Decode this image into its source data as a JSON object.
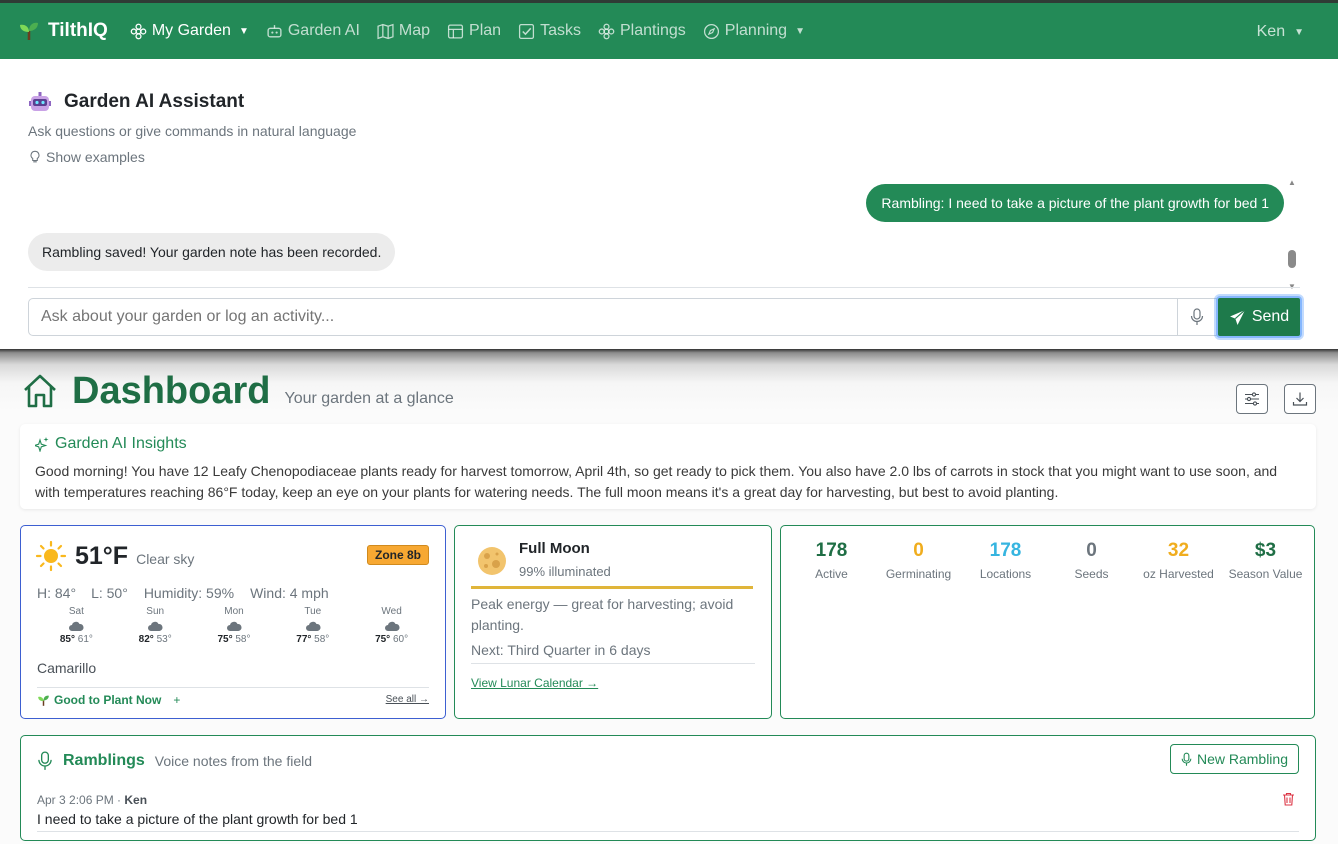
{
  "nav": {
    "brand": "TilthIQ",
    "my_garden": "My Garden",
    "items": [
      "Garden AI",
      "Map",
      "Plan",
      "Tasks",
      "Plantings",
      "Planning"
    ],
    "user": "Ken"
  },
  "assistant": {
    "title": "Garden AI Assistant",
    "subtitle": "Ask questions or give commands in natural language",
    "show_examples": "Show examples",
    "messages": [
      {
        "role": "user",
        "text": "Rambling: I need to take a picture of the plant growth for bed 1"
      },
      {
        "role": "assistant",
        "text": "Rambling saved! Your garden note has been recorded."
      }
    ],
    "input_placeholder": "Ask about your garden or log an activity...",
    "send_label": "Send"
  },
  "dashboard": {
    "title": "Dashboard",
    "subtitle": "Your garden at a glance"
  },
  "insights": {
    "title": "Garden AI Insights",
    "text": "Good morning! You have 12 Leafy Chenopodiaceae plants ready for harvest tomorrow, April 4th, so get ready to pick them. You also have 2.0 lbs of carrots in stock that you might want to use soon, and with temperatures reaching 86°F today, keep an eye on your plants for watering needs. The full moon means it's a great day for harvesting, but best to avoid planting."
  },
  "weather": {
    "temp": "51°F",
    "condition": "Clear sky",
    "zone": "Zone 8b",
    "high": "H: 84°",
    "low": "L: 50°",
    "humidity": "Humidity: 59%",
    "wind": "Wind: 4 mph",
    "forecast": [
      {
        "day": "Sat",
        "high": "85°",
        "low": "61°"
      },
      {
        "day": "Sun",
        "high": "82°",
        "low": "53°"
      },
      {
        "day": "Mon",
        "high": "75°",
        "low": "58°"
      },
      {
        "day": "Tue",
        "high": "77°",
        "low": "58°"
      },
      {
        "day": "Wed",
        "high": "75°",
        "low": "60°"
      }
    ],
    "city": "Camarillo",
    "good_to_plant": "Good to Plant Now",
    "plus": "+",
    "see_all": "See all →"
  },
  "moon": {
    "phase": "Full Moon",
    "illumination": "99% illuminated",
    "illumination_fraction": 0.99,
    "energy": "Peak energy — great for harvesting; avoid planting.",
    "next": "Next: Third Quarter in 6 days",
    "link": "View Lunar Calendar →"
  },
  "stats": [
    {
      "value": "178",
      "label": "Active",
      "color": "#1f6e45"
    },
    {
      "value": "0",
      "label": "Germinating",
      "color": "#f0ad1e"
    },
    {
      "value": "178",
      "label": "Locations",
      "color": "#36b5e0"
    },
    {
      "value": "0",
      "label": "Seeds",
      "color": "#6c757d"
    },
    {
      "value": "32",
      "label": "oz Harvested",
      "color": "#f0ad1e"
    },
    {
      "value": "$3",
      "label": "Season Value",
      "color": "#1f6e45"
    }
  ],
  "ramblings": {
    "title": "Ramblings",
    "subtitle": "Voice notes from the field",
    "new_button": "New Rambling",
    "entries": [
      {
        "time": "Apr 3 2:06 PM · ",
        "author": "Ken",
        "text": "I need to take a picture of the plant growth for bed 1"
      }
    ]
  },
  "colors": {
    "brand_green": "#238a57",
    "zone_badge": "#f7a832"
  }
}
